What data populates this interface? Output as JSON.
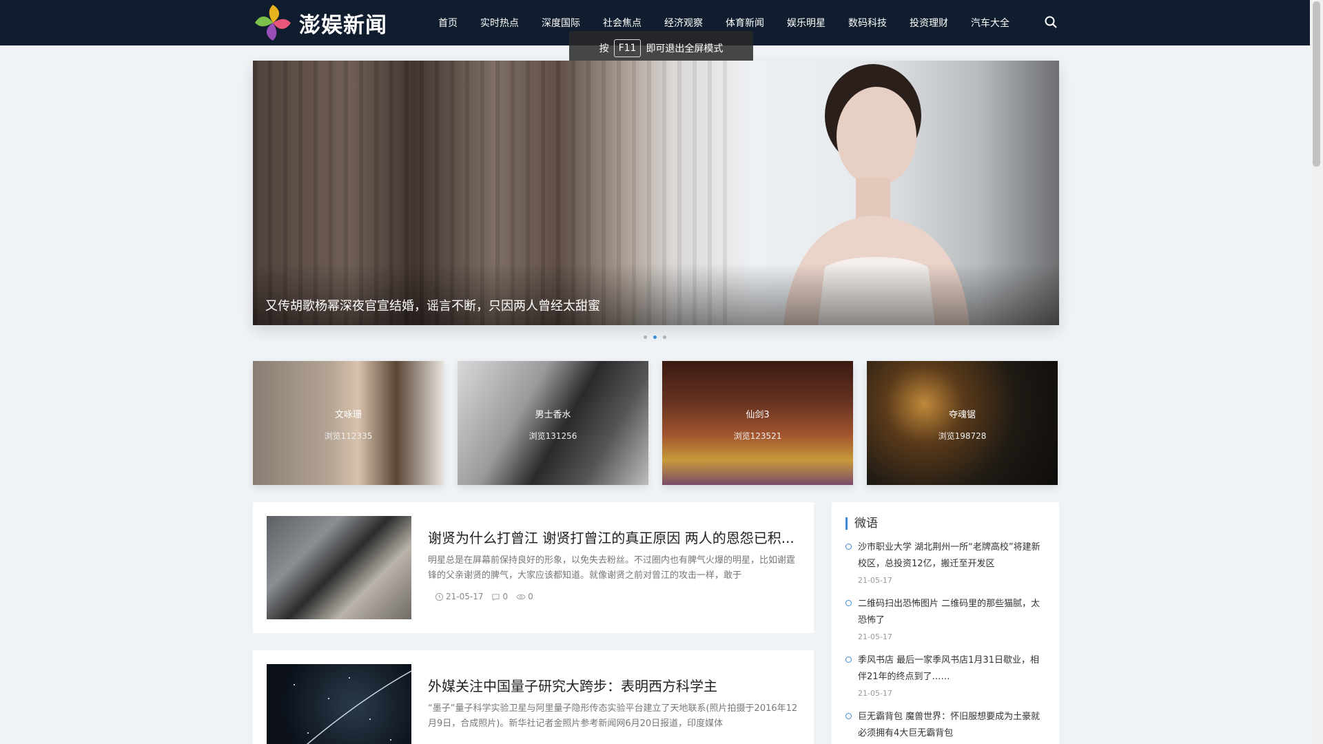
{
  "header": {
    "logo_text": "澎娱新闻",
    "nav": [
      "首页",
      "实时热点",
      "深度国际",
      "社会焦点",
      "经济观察",
      "体育新闻",
      "娱乐明星",
      "数码科技",
      "投资理财",
      "汽车大全"
    ]
  },
  "toast": {
    "before": "按",
    "key": "F11",
    "after": "即可退出全屏模式"
  },
  "hero": {
    "caption": "又传胡歌杨幂深夜官宣结婚，谣言不断，只因两人曾经太甜蜜",
    "slide_count": 3,
    "active_slide": 2
  },
  "cards": [
    {
      "title": "文咏珊",
      "views": "浏览112335"
    },
    {
      "title": "男士香水",
      "views": "浏览131256"
    },
    {
      "title": "仙剑3",
      "views": "浏览123521"
    },
    {
      "title": "夺魂锯",
      "views": "浏览198728"
    }
  ],
  "articles": [
    {
      "title": "谢贤为什么打曾江 谢贤打曾江的真正原因 两人的恩怨已积...",
      "excerpt": "明星总是在屏幕前保持良好的形象，以免失去粉丝。不过圈内也有脾气火爆的明星，比如谢霆锋的父亲谢贤的脾气，大家应该都知道。就像谢贤之前对曾江的攻击一样，敢于",
      "date": "21-05-17",
      "comments": "0",
      "views": "0"
    },
    {
      "title": "外媒关注中国量子研究大跨步：表明西方科学主",
      "excerpt": "“墨子”量子科学实验卫星与阿里量子隐形传态实验平台建立了天地联系(照片拍摄于2016年12月9日，合成照片)。新华社记者金照片参考新闻网6月20日报道，印度媒体",
      "date": "",
      "comments": "",
      "views": ""
    }
  ],
  "sidebar": {
    "title": "微语",
    "items": [
      {
        "text": "沙市职业大学 湖北荆州一所“老牌高校”将建新校区，总投资12亿，搬迁至开发区",
        "date": "21-05-17"
      },
      {
        "text": "二维码扫出恐怖图片 二维码里的那些猫腻，太恐怖了",
        "date": "21-05-17"
      },
      {
        "text": "季风书店 最后一家季风书店1月31日歇业，相伴21年的终点到了……",
        "date": "21-05-17"
      },
      {
        "text": "巨无霸背包 魔兽世界：怀旧服想要成为土豪就必须拥有4大巨无霸背包",
        "date": ""
      }
    ]
  },
  "colors": {
    "header_bg": "#0f1d2e",
    "accent": "#3b8ad9",
    "page_bg": "#eff3f6"
  },
  "icons": {
    "search": "search-icon",
    "clock": "clock-icon",
    "comment": "comment-icon",
    "eye": "eye-icon"
  }
}
